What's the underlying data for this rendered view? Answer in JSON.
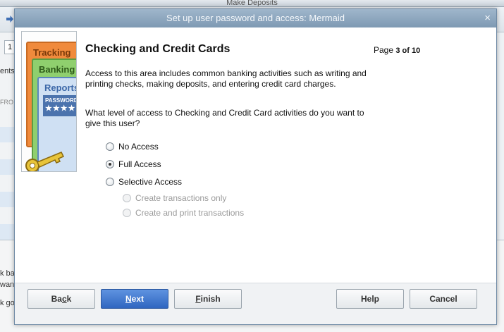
{
  "background_window": {
    "title": "Make Deposits",
    "field_value": "1",
    "left_texts": [
      "ents",
      "FRO",
      "k bac",
      "wan",
      "k go"
    ]
  },
  "dialog": {
    "title": "Set up user password and access: Mermaid",
    "close_glyph": "×"
  },
  "illustration": {
    "cards": [
      "Tracking",
      "Banking",
      "Reports"
    ],
    "password_label": "PASSWORD",
    "password_stars": "★★★★"
  },
  "page": {
    "title": "Checking and Credit Cards",
    "page_label": "Page",
    "page_number": "3 of 10"
  },
  "description": "Access to this area includes common banking activities such as writing and printing checks, making deposits, and entering credit card charges.",
  "question": "What level of access to Checking and Credit Card activities do you want to give this user?",
  "options": {
    "no_access": "No Access",
    "full_access": "Full Access",
    "selective_access": "Selective Access",
    "create_only": "Create transactions only",
    "create_and_print": "Create and print transactions"
  },
  "selected_option": "full_access",
  "buttons": {
    "back_pre": "Ba",
    "back_u": "c",
    "back_post": "k",
    "next_u": "N",
    "next_post": "ext",
    "finish_u": "F",
    "finish_post": "inish",
    "help": "Help",
    "cancel": "Cancel"
  },
  "colors": {
    "primary_button": "#2f66c0",
    "titlebar": "#8aa3bb"
  }
}
